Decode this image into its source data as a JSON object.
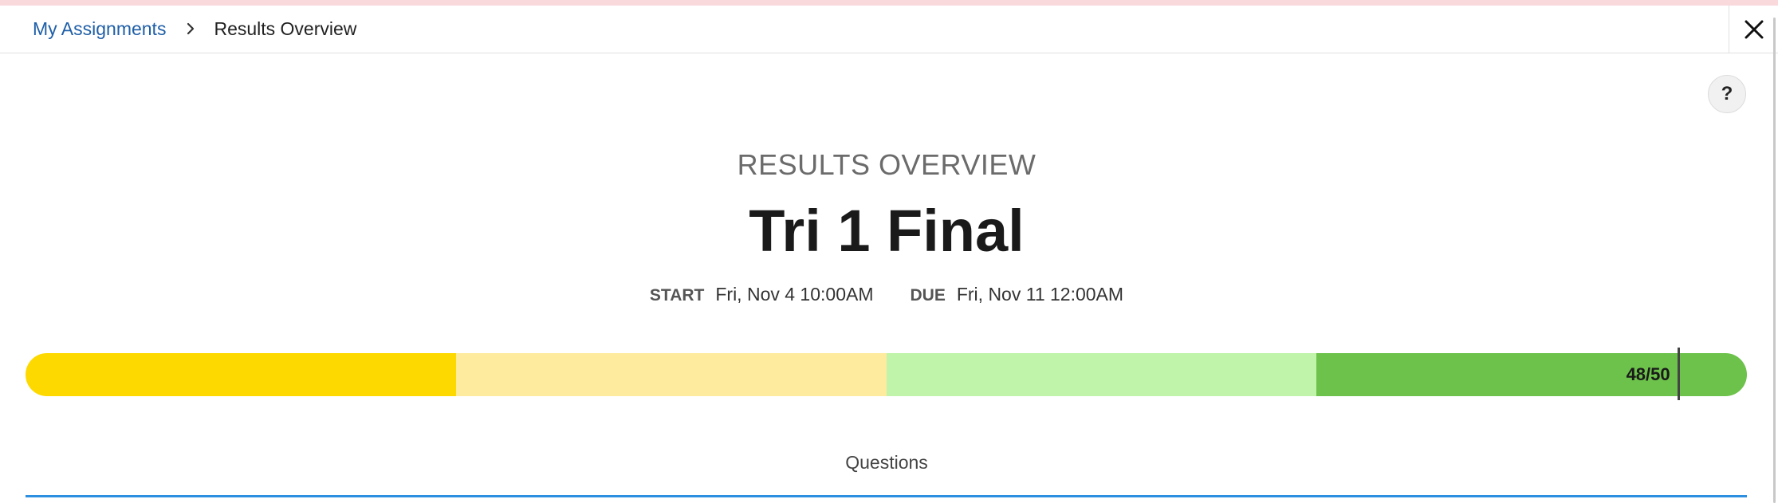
{
  "breadcrumb": {
    "parent_label": "My Assignments",
    "current_label": "Results Overview"
  },
  "header": {
    "close_icon": "close-icon"
  },
  "help": {
    "label": "?"
  },
  "page": {
    "overline": "RESULTS OVERVIEW",
    "title": "Tri 1 Final"
  },
  "dates": {
    "start_label": "START",
    "start_value": "Fri, Nov 4 10:00AM",
    "due_label": "DUE",
    "due_value": "Fri, Nov 11 12:00AM"
  },
  "score": {
    "text": "48/50",
    "earned": 48,
    "total": 50,
    "segment_colors": [
      "#fdd900",
      "#feeb9e",
      "#c0f4aa",
      "#6cc24a"
    ]
  },
  "tabs": {
    "questions_label": "Questions",
    "accent_color": "#2d8fe0"
  },
  "colors": {
    "link": "#1f5fa8",
    "top_strip": "#f9d9dc"
  }
}
